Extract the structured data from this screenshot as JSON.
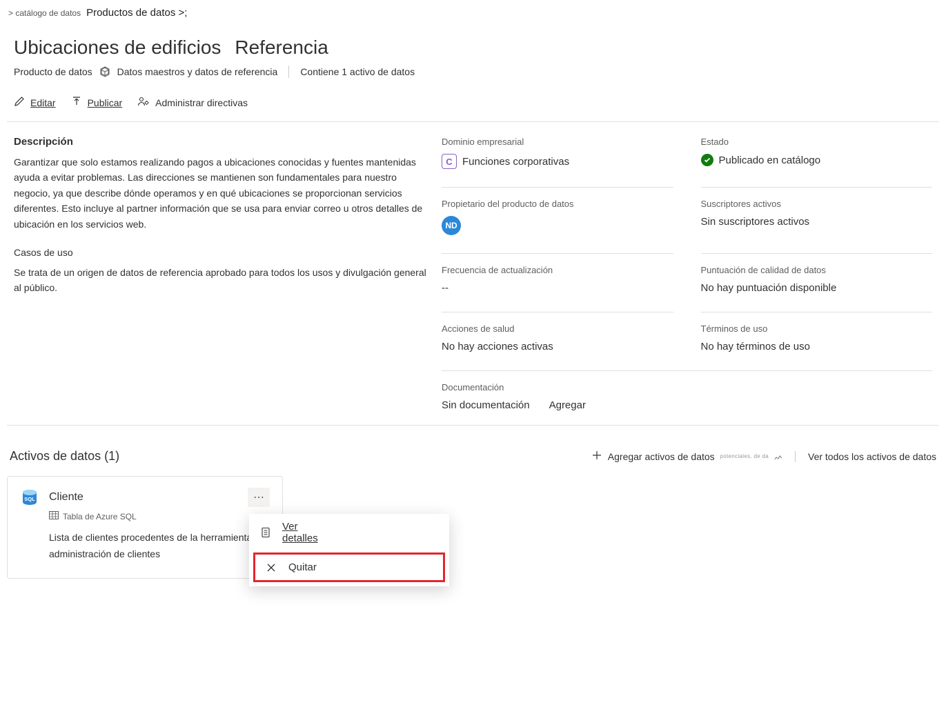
{
  "breadcrumbs": {
    "catalog": "> catálogo de datos",
    "products": "Productos de datos >;"
  },
  "header": {
    "title": "Ubicaciones de edificios",
    "badge": "Referencia",
    "product_label": "Producto de datos",
    "type_label": "Datos maestros y datos de referencia",
    "contains_label": "Contiene 1 activo de datos"
  },
  "toolbar": {
    "edit": "Editar",
    "publish": "Publicar",
    "manage_policies": "Administrar directivas"
  },
  "description": {
    "label": "Descripción",
    "text": "Garantizar que solo estamos realizando pagos a ubicaciones conocidas y fuentes mantenidas ayuda a evitar problemas.     Las direcciones se mantienen son fundamentales para nuestro negocio, ya que describe dónde operamos y en qué ubicaciones se proporcionan servicios diferentes.    Esto incluye al partner información que se usa para enviar correo u otros detalles de ubicación en los servicios web.",
    "use_cases_label": "Casos de uso",
    "use_cases_text": "Se trata de un origen de datos de referencia aprobado para todos los usos y divulgación general al público."
  },
  "meta": {
    "domain_label": "Dominio empresarial",
    "domain_chip": "C",
    "domain_value": "Funciones corporativas",
    "status_label": "Estado",
    "status_value": "Publicado en catálogo",
    "owner_label": "Propietario del producto de datos",
    "owner_initials": "ND",
    "subscribers_label": "Suscriptores activos",
    "subscribers_value": "Sin suscriptores activos",
    "frequency_label": "Frecuencia de actualización",
    "frequency_value": "--",
    "quality_label": "Puntuación de calidad de datos",
    "quality_value": "No hay puntuación disponible",
    "health_label": "Acciones de salud",
    "health_value": "No hay acciones activas",
    "terms_label": "Términos de uso",
    "terms_value": "No hay términos de uso",
    "docs_label": "Documentación",
    "docs_value": "Sin documentación",
    "docs_add": "Agregar"
  },
  "assets": {
    "title": "Activos de datos (1)",
    "add_label": "Agregar activos de datos",
    "add_sub": "potenciales. de da",
    "view_all": "Ver todos los activos de datos",
    "card": {
      "name": "Cliente",
      "type": "Tabla de Azure SQL",
      "desc": "Lista de clientes procedentes de la herramienta de administración de clientes"
    }
  },
  "context_menu": {
    "view_details": "Ver detalles",
    "remove": "Quitar"
  }
}
